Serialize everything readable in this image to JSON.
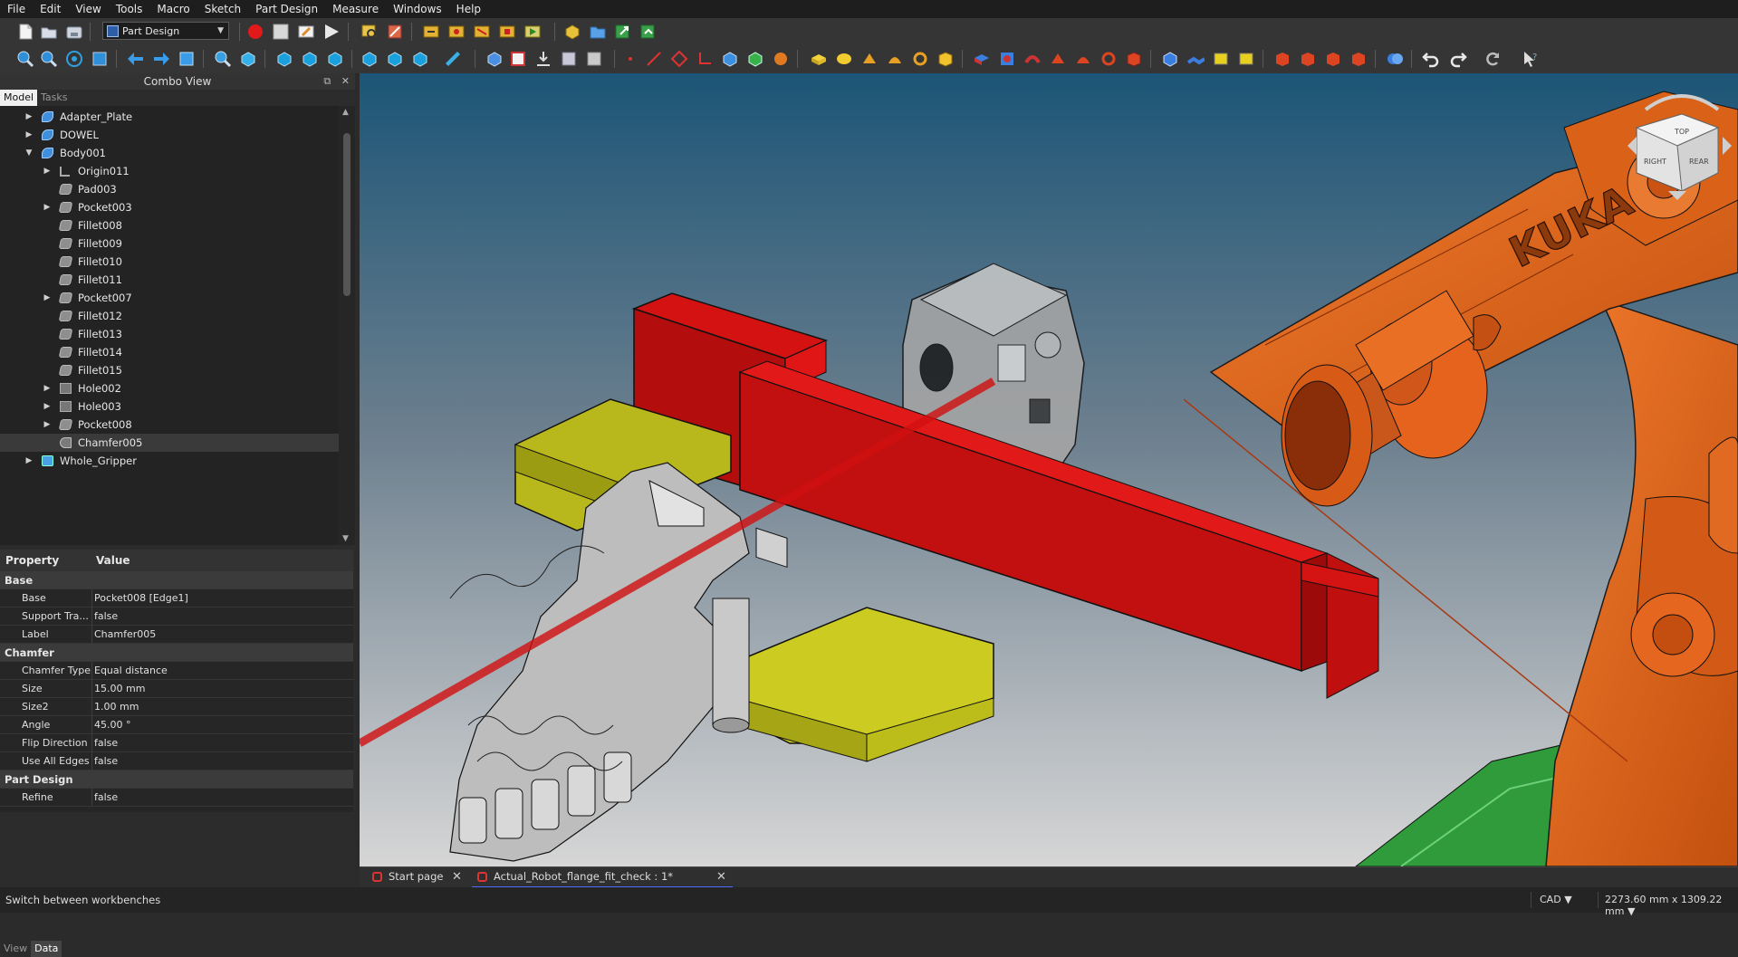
{
  "menu": [
    "File",
    "Edit",
    "View",
    "Tools",
    "Macro",
    "Sketch",
    "Part Design",
    "Measure",
    "Windows",
    "Help"
  ],
  "workbench": {
    "label": "Part Design"
  },
  "combo_view": {
    "title": "Combo View",
    "tabs": [
      "Model",
      "Tasks"
    ],
    "tree": [
      {
        "label": "Adapter_Plate",
        "level": 0,
        "icon": "body-icon",
        "expander": "collapsed"
      },
      {
        "label": "DOWEL",
        "level": 0,
        "icon": "body-icon",
        "expander": "collapsed"
      },
      {
        "label": "Body001",
        "level": 0,
        "icon": "body-icon",
        "expander": "expanded"
      },
      {
        "label": "Origin011",
        "level": 1,
        "icon": "origin-icon",
        "expander": "collapsed"
      },
      {
        "label": "Pad003",
        "level": 1,
        "icon": "pad-icon",
        "expander": "none"
      },
      {
        "label": "Pocket003",
        "level": 1,
        "icon": "pocket-icon",
        "expander": "collapsed"
      },
      {
        "label": "Fillet008",
        "level": 1,
        "icon": "fillet-icon",
        "expander": "none"
      },
      {
        "label": "Fillet009",
        "level": 1,
        "icon": "fillet-icon",
        "expander": "none"
      },
      {
        "label": "Fillet010",
        "level": 1,
        "icon": "fillet-icon",
        "expander": "none"
      },
      {
        "label": "Fillet011",
        "level": 1,
        "icon": "fillet-icon",
        "expander": "none"
      },
      {
        "label": "Pocket007",
        "level": 1,
        "icon": "pocket-icon",
        "expander": "collapsed"
      },
      {
        "label": "Fillet012",
        "level": 1,
        "icon": "fillet-icon",
        "expander": "none"
      },
      {
        "label": "Fillet013",
        "level": 1,
        "icon": "fillet-icon",
        "expander": "none"
      },
      {
        "label": "Fillet014",
        "level": 1,
        "icon": "fillet-icon",
        "expander": "none"
      },
      {
        "label": "Fillet015",
        "level": 1,
        "icon": "fillet-icon",
        "expander": "none"
      },
      {
        "label": "Hole002",
        "level": 1,
        "icon": "hole-icon",
        "expander": "collapsed"
      },
      {
        "label": "Hole003",
        "level": 1,
        "icon": "hole-icon",
        "expander": "collapsed"
      },
      {
        "label": "Pocket008",
        "level": 1,
        "icon": "pocket-icon",
        "expander": "collapsed"
      },
      {
        "label": "Chamfer005",
        "level": 1,
        "icon": "chamfer-icon",
        "expander": "none",
        "selected": true
      },
      {
        "label": "Whole_Gripper",
        "level": 0,
        "icon": "group-icon",
        "expander": "collapsed"
      }
    ]
  },
  "property_editor": {
    "headers": {
      "property": "Property",
      "value": "Value"
    },
    "groups": [
      {
        "name": "Base",
        "rows": [
          {
            "name": "Base",
            "value": "Pocket008 [Edge1]"
          },
          {
            "name": "Support Tra...",
            "value": "false"
          },
          {
            "name": "Label",
            "value": "Chamfer005"
          }
        ]
      },
      {
        "name": "Chamfer",
        "rows": [
          {
            "name": "Chamfer Type",
            "value": "Equal distance"
          },
          {
            "name": "Size",
            "value": "15.00 mm"
          },
          {
            "name": "Size2",
            "value": "1.00 mm"
          },
          {
            "name": "Angle",
            "value": "45.00 °"
          },
          {
            "name": "Flip Direction",
            "value": "false"
          },
          {
            "name": "Use All Edges",
            "value": "false"
          }
        ]
      },
      {
        "name": "Part Design",
        "rows": [
          {
            "name": "Refine",
            "value": "false"
          }
        ]
      }
    ],
    "bottom_tabs": [
      "View",
      "Data"
    ]
  },
  "document_tabs": [
    {
      "label": "Start page",
      "active": false
    },
    {
      "label": "Actual_Robot_flange_fit_check : 1*",
      "active": true
    }
  ],
  "viewport": {
    "robot_brand_text": "KUKA",
    "navcube_faces": [
      "TOP",
      "RIGHT",
      "REAR"
    ]
  },
  "status": {
    "message": "Switch between workbenches",
    "navigation_style": "CAD",
    "dimensions": "2273.60 mm x 1309.22 mm"
  },
  "colors": {
    "robot_orange": "#e0611c",
    "bracket_red": "#c40f0f",
    "pad_yellow": "#c9c820",
    "base_green": "#2e9a3a"
  }
}
